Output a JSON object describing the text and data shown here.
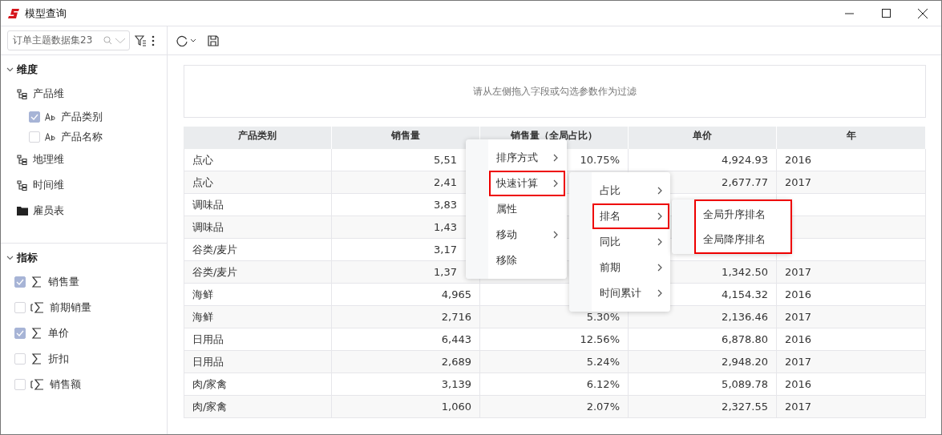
{
  "window": {
    "title": "模型查询"
  },
  "sidebar": {
    "dataset_select": {
      "value": "订单主题数据集23"
    },
    "sections": [
      {
        "title": "维度",
        "expanded": true,
        "items": [
          {
            "kind": "hierarchy",
            "label": "产品维",
            "children": [
              {
                "kind": "text_field",
                "label": "产品类别",
                "checked": true
              },
              {
                "kind": "text_field",
                "label": "产品名称",
                "checked": false
              }
            ]
          },
          {
            "kind": "hierarchy",
            "label": "地理维"
          },
          {
            "kind": "hierarchy",
            "label": "时间维"
          },
          {
            "kind": "table",
            "label": "雇员表"
          }
        ]
      },
      {
        "title": "指标",
        "expanded": true,
        "items": [
          {
            "kind": "measure",
            "label": "销售量",
            "checked": true
          },
          {
            "kind": "calculated_measure",
            "label": "前期销量",
            "checked": false
          },
          {
            "kind": "measure",
            "label": "单价",
            "checked": true
          },
          {
            "kind": "measure",
            "label": "折扣",
            "checked": false
          },
          {
            "kind": "calculated_measure",
            "label": "销售额",
            "checked": false
          }
        ]
      }
    ]
  },
  "filter_area": {
    "placeholder": "请从左侧拖入字段或勾选参数作为过滤"
  },
  "table": {
    "columns": [
      "产品类别",
      "销售量",
      "销售量（全局占比）",
      "单价",
      "年"
    ],
    "rows": [
      {
        "cells": [
          "点心",
          {
            "text": "5,51",
            "cut_off": true
          },
          "10.75%",
          "4,924.93",
          "2016"
        ]
      },
      {
        "cells": [
          "点心",
          {
            "text": "2,41",
            "cut_off": true
          },
          null,
          "2,677.77",
          "2017"
        ]
      },
      {
        "cells": [
          "调味品",
          {
            "text": "3,83",
            "cut_off": true
          },
          null,
          null,
          null
        ]
      },
      {
        "cells": [
          "调味品",
          {
            "text": "1,43",
            "cut_off": true
          },
          null,
          null,
          null
        ]
      },
      {
        "cells": [
          "谷类/麦片",
          {
            "text": "3,17",
            "cut_off": true
          },
          null,
          null,
          null
        ]
      },
      {
        "cells": [
          "谷类/麦片",
          {
            "text": "1,37",
            "cut_off": true
          },
          null,
          "1,342.50",
          "2017"
        ]
      },
      {
        "cells": [
          "海鲜",
          "4,965",
          null,
          "4,154.32",
          "2016"
        ]
      },
      {
        "cells": [
          "海鲜",
          "2,716",
          "5.30%",
          "2,136.46",
          "2017"
        ]
      },
      {
        "cells": [
          "日用品",
          "6,443",
          "12.56%",
          "6,878.80",
          "2016"
        ]
      },
      {
        "cells": [
          "日用品",
          "2,689",
          "5.24%",
          "2,948.20",
          "2017"
        ]
      },
      {
        "cells": [
          "肉/家禽",
          "3,139",
          "6.12%",
          "5,089.78",
          "2016"
        ]
      },
      {
        "cells": [
          "肉/家禽",
          "1,060",
          "2.07%",
          "2,327.55",
          "2017"
        ]
      }
    ]
  },
  "context_menu": {
    "items": [
      {
        "label": "排序方式",
        "has_submenu": true,
        "highlighted": false
      },
      {
        "label": "快速计算",
        "has_submenu": true,
        "highlighted": true
      },
      {
        "label": "属性",
        "has_submenu": false,
        "highlighted": false
      },
      {
        "label": "移动",
        "has_submenu": true,
        "highlighted": false
      },
      {
        "label": "移除",
        "has_submenu": false,
        "highlighted": false
      }
    ]
  },
  "quick_calc_menu": {
    "items": [
      {
        "label": "占比",
        "has_submenu": true,
        "highlighted": false
      },
      {
        "label": "排名",
        "has_submenu": true,
        "highlighted": true
      },
      {
        "label": "同比",
        "has_submenu": true,
        "highlighted": false
      },
      {
        "label": "前期",
        "has_submenu": true,
        "highlighted": false
      },
      {
        "label": "时间累计",
        "has_submenu": true,
        "highlighted": false
      }
    ]
  },
  "rank_menu": {
    "highlighted": true,
    "items": [
      {
        "label": "全局升序排名"
      },
      {
        "label": "全局降序排名"
      }
    ]
  }
}
